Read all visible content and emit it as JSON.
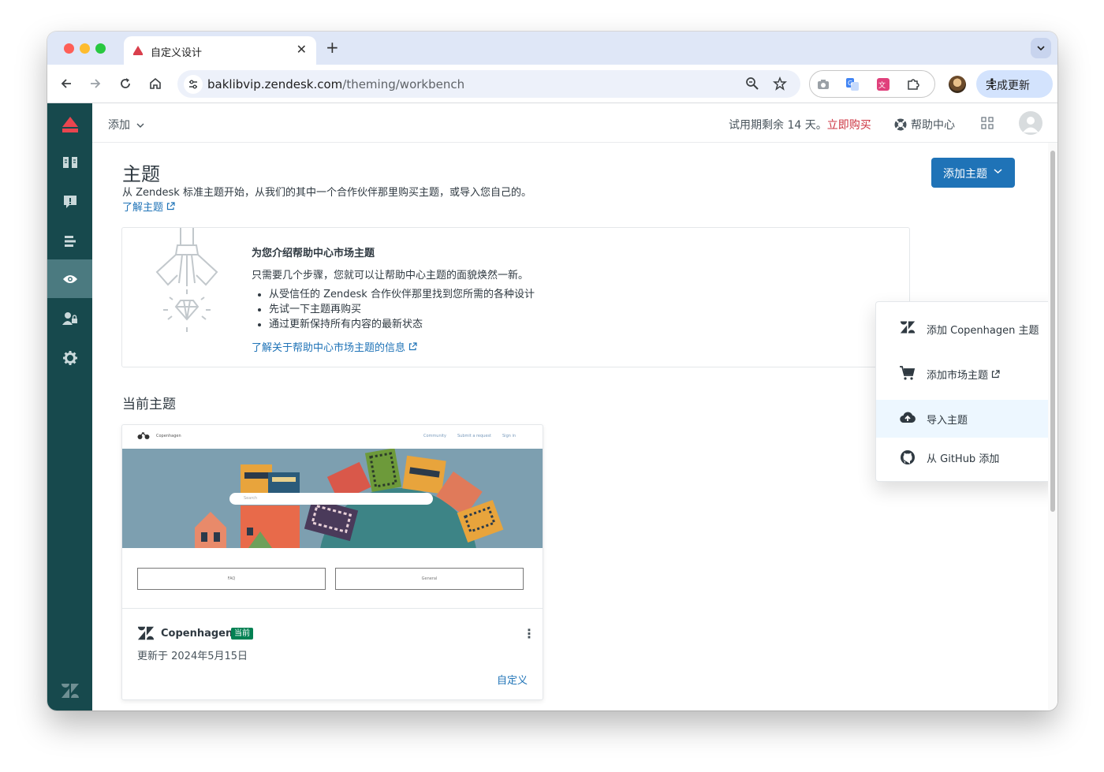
{
  "browser": {
    "tab_title": "自定义设计",
    "url_host": "baklibvip.zendesk.com",
    "url_path": "/theming/workbench",
    "update_label": "完成更新"
  },
  "topbar": {
    "add_label": "添加",
    "trial_text": "试用期剩余 14 天。",
    "buy_label": "立即购买",
    "help_center_label": "帮助中心"
  },
  "page": {
    "title": "主题",
    "description": "从 Zendesk 标准主题开始，从我们的其中一个合作伙伴那里购买主题，或导入您自己的。",
    "learn_link": "了解主题",
    "add_theme_button": "添加主题"
  },
  "marketplace": {
    "title": "为您介绍帮助中心市场主题",
    "text": "只需要几个步骤，您就可以让帮助中心主题的面貌焕然一新。",
    "bullets": [
      "从受信任的 Zendesk 合作伙伴那里找到您所需的各种设计",
      "先试一下主题再购买",
      "通过更新保持所有内容的最新状态"
    ],
    "link": "了解关于帮助中心市场主题的信息"
  },
  "current": {
    "heading": "当前主题",
    "theme_name": "Copenhagen",
    "badge": "当前",
    "updated": "更新于 2024年5月15日",
    "customize": "自定义",
    "preview": {
      "brand": "Copenhagen",
      "nav": [
        "Community",
        "Submit a request",
        "Sign in"
      ],
      "search_placeholder": "Search",
      "boxes": [
        "FAQ",
        "General"
      ]
    }
  },
  "dropdown": {
    "items": [
      {
        "label": "添加 Copenhagen 主题",
        "icon": "zendesk-icon"
      },
      {
        "label": "添加市场主题",
        "icon": "cart-icon"
      },
      {
        "label": "导入主题",
        "icon": "cloud-upload-icon"
      },
      {
        "label": "从 GitHub 添加",
        "icon": "github-icon"
      }
    ]
  },
  "colors": {
    "rail": "#17494d",
    "primary": "#1f73b7",
    "buy": "#cc3340",
    "badge": "#038153"
  }
}
